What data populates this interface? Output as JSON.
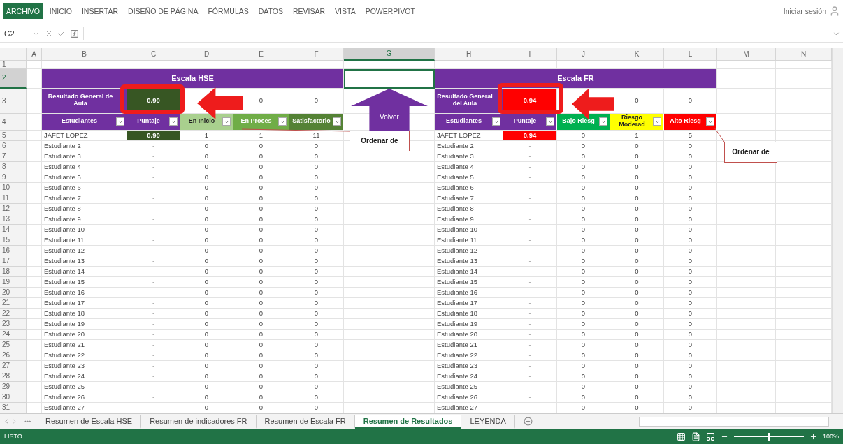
{
  "ribbon": {
    "tabs": [
      {
        "label": "ARCHIVO",
        "selected": true
      },
      {
        "label": "INICIO",
        "selected": false
      },
      {
        "label": "INSERTAR",
        "selected": false
      },
      {
        "label": "DISEÑO DE PÁGINA",
        "selected": false
      },
      {
        "label": "FÓRMULAS",
        "selected": false
      },
      {
        "label": "DATOS",
        "selected": false
      },
      {
        "label": "REVISAR",
        "selected": false
      },
      {
        "label": "VISTA",
        "selected": false
      },
      {
        "label": "POWERPIVOT",
        "selected": false
      }
    ],
    "sign_in": "Iniciar sesión"
  },
  "formula_bar": {
    "name_box": "G2"
  },
  "columns": [
    {
      "label": "A",
      "selected": false
    },
    {
      "label": "B",
      "selected": false
    },
    {
      "label": "C",
      "selected": false
    },
    {
      "label": "D",
      "selected": false
    },
    {
      "label": "E",
      "selected": false
    },
    {
      "label": "F",
      "selected": false
    },
    {
      "label": "G",
      "selected": true
    },
    {
      "label": "H",
      "selected": false
    },
    {
      "label": "I",
      "selected": false
    },
    {
      "label": "J",
      "selected": false
    },
    {
      "label": "K",
      "selected": false
    },
    {
      "label": "L",
      "selected": false
    },
    {
      "label": "M",
      "selected": false
    },
    {
      "label": "N",
      "selected": false
    }
  ],
  "row_numbers": [
    {
      "label": "1",
      "selected": false
    },
    {
      "label": "2",
      "selected": true
    },
    {
      "label": "3",
      "selected": false
    },
    {
      "label": "4",
      "selected": false
    },
    {
      "label": "5",
      "selected": false
    },
    {
      "label": "6",
      "selected": false
    },
    {
      "label": "7",
      "selected": false
    },
    {
      "label": "8",
      "selected": false
    },
    {
      "label": "9",
      "selected": false
    },
    {
      "label": "10",
      "selected": false
    },
    {
      "label": "11",
      "selected": false
    },
    {
      "label": "12",
      "selected": false
    },
    {
      "label": "13",
      "selected": false
    },
    {
      "label": "14",
      "selected": false
    },
    {
      "label": "15",
      "selected": false
    },
    {
      "label": "16",
      "selected": false
    },
    {
      "label": "17",
      "selected": false
    },
    {
      "label": "18",
      "selected": false
    },
    {
      "label": "19",
      "selected": false
    },
    {
      "label": "20",
      "selected": false
    },
    {
      "label": "21",
      "selected": false
    },
    {
      "label": "22",
      "selected": false
    },
    {
      "label": "23",
      "selected": false
    },
    {
      "label": "24",
      "selected": false
    },
    {
      "label": "25",
      "selected": false
    },
    {
      "label": "26",
      "selected": false
    },
    {
      "label": "27",
      "selected": false
    },
    {
      "label": "28",
      "selected": false
    },
    {
      "label": "29",
      "selected": false
    },
    {
      "label": "30",
      "selected": false
    },
    {
      "label": "31",
      "selected": false
    }
  ],
  "tables": [
    {
      "title": "Escala HSE",
      "result": {
        "label": "Resultado General de Aula",
        "value": "0.90",
        "color": "#375623"
      },
      "totals": [
        "0",
        "0"
      ],
      "headers": [
        {
          "label": "Estudiantes",
          "color": "#7030a0"
        },
        {
          "label": "Puntaje",
          "color": "#7030a0"
        },
        {
          "label": "En Inicio",
          "color": "#a9d08e"
        },
        {
          "label": "En Proces",
          "color": "#70ad47"
        },
        {
          "label": "Satisfactorio",
          "color": "#548235"
        }
      ],
      "rows": [
        {
          "name": "JAFET LOPEZ",
          "score": "0.90",
          "color": "#375623",
          "values": [
            "1",
            "1",
            "11"
          ]
        },
        {
          "name": "Estudiante 2",
          "score": "-",
          "values": [
            "0",
            "0",
            "0"
          ]
        },
        {
          "name": "Estudiante 3",
          "score": "-",
          "values": [
            "0",
            "0",
            "0"
          ]
        },
        {
          "name": "Estudiante 4",
          "score": "-",
          "values": [
            "0",
            "0",
            "0"
          ]
        },
        {
          "name": "Estudiante 5",
          "score": "-",
          "values": [
            "0",
            "0",
            "0"
          ]
        },
        {
          "name": "Estudiante 6",
          "score": "-",
          "values": [
            "0",
            "0",
            "0"
          ]
        },
        {
          "name": "Estudiante 7",
          "score": "-",
          "values": [
            "0",
            "0",
            "0"
          ]
        },
        {
          "name": "Estudiante 8",
          "score": "-",
          "values": [
            "0",
            "0",
            "0"
          ]
        },
        {
          "name": "Estudiante 9",
          "score": "-",
          "values": [
            "0",
            "0",
            "0"
          ]
        },
        {
          "name": "Estudiante 10",
          "score": "-",
          "values": [
            "0",
            "0",
            "0"
          ]
        },
        {
          "name": "Estudiante 11",
          "score": "-",
          "values": [
            "0",
            "0",
            "0"
          ]
        },
        {
          "name": "Estudiante 12",
          "score": "-",
          "values": [
            "0",
            "0",
            "0"
          ]
        },
        {
          "name": "Estudiante 13",
          "score": "-",
          "values": [
            "0",
            "0",
            "0"
          ]
        },
        {
          "name": "Estudiante 14",
          "score": "-",
          "values": [
            "0",
            "0",
            "0"
          ]
        },
        {
          "name": "Estudiante 15",
          "score": "-",
          "values": [
            "0",
            "0",
            "0"
          ]
        },
        {
          "name": "Estudiante 16",
          "score": "-",
          "values": [
            "0",
            "0",
            "0"
          ]
        },
        {
          "name": "Estudiante 17",
          "score": "-",
          "values": [
            "0",
            "0",
            "0"
          ]
        },
        {
          "name": "Estudiante 18",
          "score": "-",
          "values": [
            "0",
            "0",
            "0"
          ]
        },
        {
          "name": "Estudiante 19",
          "score": "-",
          "values": [
            "0",
            "0",
            "0"
          ]
        },
        {
          "name": "Estudiante 20",
          "score": "-",
          "values": [
            "0",
            "0",
            "0"
          ]
        },
        {
          "name": "Estudiante 21",
          "score": "-",
          "values": [
            "0",
            "0",
            "0"
          ]
        },
        {
          "name": "Estudiante 22",
          "score": "-",
          "values": [
            "0",
            "0",
            "0"
          ]
        },
        {
          "name": "Estudiante 23",
          "score": "-",
          "values": [
            "0",
            "0",
            "0"
          ]
        },
        {
          "name": "Estudiante 24",
          "score": "-",
          "values": [
            "0",
            "0",
            "0"
          ]
        },
        {
          "name": "Estudiante 25",
          "score": "-",
          "values": [
            "0",
            "0",
            "0"
          ]
        },
        {
          "name": "Estudiante 26",
          "score": "-",
          "values": [
            "0",
            "0",
            "0"
          ]
        },
        {
          "name": "Estudiante 27",
          "score": "-",
          "values": [
            "0",
            "0",
            "0"
          ]
        }
      ]
    },
    {
      "title": "Escala FR",
      "result": {
        "label": "Resultado General del Aula",
        "value": "0.94",
        "color": "#ff0000"
      },
      "totals": [
        "0",
        "0"
      ],
      "headers": [
        {
          "label": "Estudiantes",
          "color": "#7030a0"
        },
        {
          "label": "Puntaje",
          "color": "#7030a0"
        },
        {
          "label": "Bajo Riesg",
          "color": "#00b050"
        },
        {
          "label": "Riesgo Moderad",
          "color": "#ffff00"
        },
        {
          "label": "Alto Riesg",
          "color": "#ff0000"
        }
      ],
      "rows": [
        {
          "name": "JAFET LOPEZ",
          "score": "0.94",
          "color": "#ff0000",
          "values": [
            "0",
            "1",
            "5"
          ]
        },
        {
          "name": "Estudiante 2",
          "score": "-",
          "values": [
            "0",
            "0",
            "0"
          ]
        },
        {
          "name": "Estudiante 3",
          "score": "-",
          "values": [
            "0",
            "0",
            "0"
          ]
        },
        {
          "name": "Estudiante 4",
          "score": "-",
          "values": [
            "0",
            "0",
            "0"
          ]
        },
        {
          "name": "Estudiante 5",
          "score": "-",
          "values": [
            "0",
            "0",
            "0"
          ]
        },
        {
          "name": "Estudiante 6",
          "score": "-",
          "values": [
            "0",
            "0",
            "0"
          ]
        },
        {
          "name": "Estudiante 7",
          "score": "-",
          "values": [
            "0",
            "0",
            "0"
          ]
        },
        {
          "name": "Estudiante 8",
          "score": "-",
          "values": [
            "0",
            "0",
            "0"
          ]
        },
        {
          "name": "Estudiante 9",
          "score": "-",
          "values": [
            "0",
            "0",
            "0"
          ]
        },
        {
          "name": "Estudiante 10",
          "score": "-",
          "values": [
            "0",
            "0",
            "0"
          ]
        },
        {
          "name": "Estudiante 11",
          "score": "-",
          "values": [
            "0",
            "0",
            "0"
          ]
        },
        {
          "name": "Estudiante 12",
          "score": "-",
          "values": [
            "0",
            "0",
            "0"
          ]
        },
        {
          "name": "Estudiante 13",
          "score": "-",
          "values": [
            "0",
            "0",
            "0"
          ]
        },
        {
          "name": "Estudiante 14",
          "score": "-",
          "values": [
            "0",
            "0",
            "0"
          ]
        },
        {
          "name": "Estudiante 15",
          "score": "-",
          "values": [
            "0",
            "0",
            "0"
          ]
        },
        {
          "name": "Estudiante 16",
          "score": "-",
          "values": [
            "0",
            "0",
            "0"
          ]
        },
        {
          "name": "Estudiante 17",
          "score": "-",
          "values": [
            "0",
            "0",
            "0"
          ]
        },
        {
          "name": "Estudiante 18",
          "score": "-",
          "values": [
            "0",
            "0",
            "0"
          ]
        },
        {
          "name": "Estudiante 19",
          "score": "-",
          "values": [
            "0",
            "0",
            "0"
          ]
        },
        {
          "name": "Estudiante 20",
          "score": "-",
          "values": [
            "0",
            "0",
            "0"
          ]
        },
        {
          "name": "Estudiante 21",
          "score": "-",
          "values": [
            "0",
            "0",
            "0"
          ]
        },
        {
          "name": "Estudiante 22",
          "score": "-",
          "values": [
            "0",
            "0",
            "0"
          ]
        },
        {
          "name": "Estudiante 23",
          "score": "-",
          "values": [
            "0",
            "0",
            "0"
          ]
        },
        {
          "name": "Estudiante 24",
          "score": "-",
          "values": [
            "0",
            "0",
            "0"
          ]
        },
        {
          "name": "Estudiante 25",
          "score": "-",
          "values": [
            "0",
            "0",
            "0"
          ]
        },
        {
          "name": "Estudiante 26",
          "score": "-",
          "values": [
            "0",
            "0",
            "0"
          ]
        },
        {
          "name": "Estudiante 27",
          "score": "-",
          "values": [
            "0",
            "0",
            "0"
          ]
        }
      ]
    }
  ],
  "back_button": "Volver",
  "callouts": [
    "Ordenar de",
    "Ordenar de"
  ],
  "sheet_tabs": [
    {
      "label": "Resumen de Escala HSE",
      "selected": false
    },
    {
      "label": "Resumen de indicadores FR",
      "selected": false
    },
    {
      "label": "Resumen de Escala FR",
      "selected": false
    },
    {
      "label": "Resumen de Resultados",
      "selected": true
    },
    {
      "label": "LEYENDA",
      "selected": false
    }
  ],
  "status_bar": {
    "status": "LISTO",
    "zoom": "100%",
    "zoom_slider": {
      "level": 0.5
    }
  }
}
